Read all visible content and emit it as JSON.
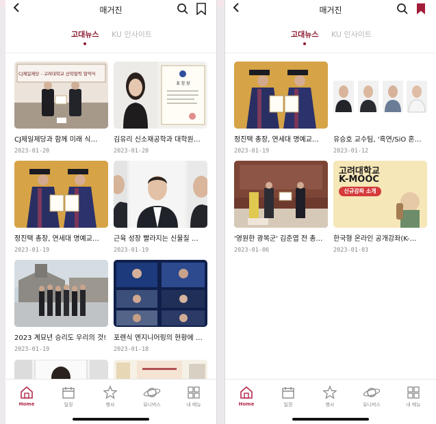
{
  "header": {
    "title": "매거진"
  },
  "tabs": [
    {
      "label": "고대뉴스",
      "active": true
    },
    {
      "label": "KU 인사이트",
      "active": false
    }
  ],
  "left_articles": [
    {
      "title": "CJ제일제당과 함께 미래 식…",
      "date": "2023-01-20",
      "banner": "CJ제일제당 - 고려대학교 산학협력 협약식"
    },
    {
      "title": "김유리 신소재공학과 대학원…",
      "date": "2023-01-20",
      "certificate": "표 창 장"
    },
    {
      "title": "정진택 총장, 연세대 명예교…",
      "date": "2023-01-19"
    },
    {
      "title": "근육 성장 빨라지는 신물질 …",
      "date": "2023-01-19"
    },
    {
      "title": "2023 계묘년 승리도 우리의 것!",
      "date": "2023-01-19"
    },
    {
      "title": "포렌식 엔지니어링의 현황에 …",
      "date": "2023-01-18"
    }
  ],
  "right_articles": [
    {
      "title": "정진택 총장, 연세대 명예교…",
      "date": "2023-01-19"
    },
    {
      "title": "유승호 교수팀, '흑연/SiO 혼…",
      "date": "2023-01-12"
    },
    {
      "title": "'영원한 광복군' 김준엽 전 총…",
      "date": "2023-01-06"
    },
    {
      "title": "한국형 온라인 공개강좌(K-…",
      "date": "2023-01-03",
      "poster_line1": "고려대학교",
      "poster_line2": "K-MOOC",
      "poster_badge": "신규강좌 소개"
    }
  ],
  "bottom_nav": [
    {
      "label": "Home",
      "icon": "home-icon",
      "active": true
    },
    {
      "label": "일정",
      "icon": "calendar-icon",
      "active": false
    },
    {
      "label": "행사",
      "icon": "star-icon",
      "active": false
    },
    {
      "label": "유니버스",
      "icon": "planet-icon",
      "active": false
    },
    {
      "label": "내 메뉴",
      "icon": "grid-menu-icon",
      "active": false
    }
  ],
  "colors": {
    "brand": "#8b1a30",
    "nav_active": "#b3294a"
  }
}
